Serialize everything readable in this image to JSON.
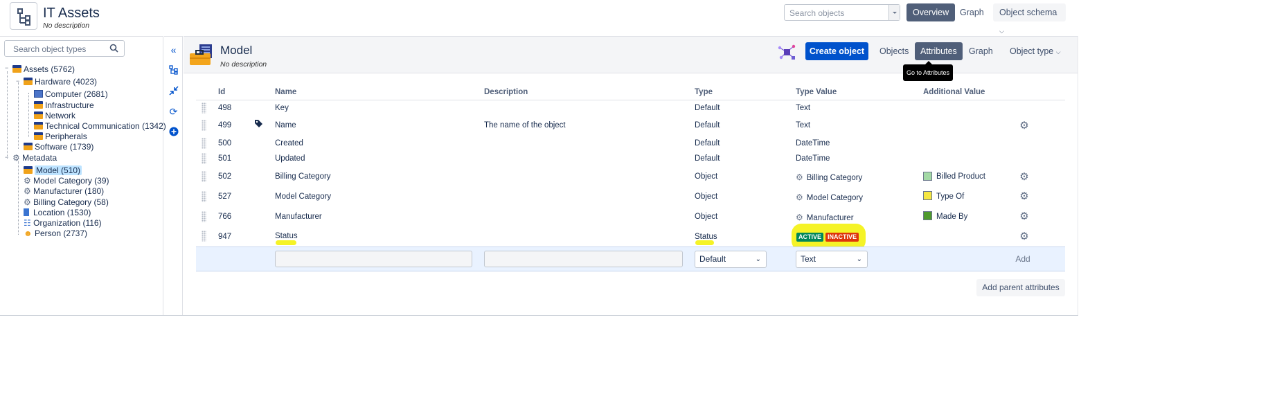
{
  "app": {
    "title": "IT Assets",
    "description": "No description"
  },
  "header": {
    "search_placeholder": "Search objects",
    "nav": {
      "overview": "Overview",
      "graph": "Graph",
      "object_schema": "Object schema"
    }
  },
  "sidebar": {
    "search_placeholder": "Search object types",
    "tree": [
      {
        "label": "Assets (5762)",
        "icon": "folder-icon"
      },
      {
        "label": "Hardware (4023)",
        "icon": "folder-icon"
      },
      {
        "label": "Computer (2681)",
        "icon": "monitor-icon"
      },
      {
        "label": "Infrastructure",
        "icon": "folder-icon"
      },
      {
        "label": "Network",
        "icon": "folder-icon"
      },
      {
        "label": "Technical Communication (1342)",
        "icon": "folder-icon"
      },
      {
        "label": "Peripherals",
        "icon": "folder-icon"
      },
      {
        "label": "Software (1739)",
        "icon": "folder-icon"
      },
      {
        "label": "Metadata",
        "icon": "gear-icon"
      },
      {
        "label": "Model (510)",
        "icon": "folder-icon",
        "selected": true
      },
      {
        "label": "Model Category (39)",
        "icon": "gear-icon"
      },
      {
        "label": "Manufacturer (180)",
        "icon": "gear-icon"
      },
      {
        "label": "Billing Category (58)",
        "icon": "gear-icon"
      },
      {
        "label": "Location (1530)",
        "icon": "building-icon"
      },
      {
        "label": "Organization (116)",
        "icon": "org-chart-icon"
      },
      {
        "label": "Person (2737)",
        "icon": "person-icon"
      }
    ]
  },
  "main": {
    "title": "Model",
    "description": "No description",
    "create_label": "Create object",
    "tabs": {
      "objects": "Objects",
      "attributes": "Attributes",
      "graph": "Graph",
      "object_type": "Object type"
    },
    "tooltip": "Go to Attributes",
    "columns": {
      "id": "Id",
      "name": "Name",
      "description": "Description",
      "type": "Type",
      "type_value": "Type Value",
      "additional_value": "Additional Value"
    },
    "rows": [
      {
        "id": "498",
        "name": "Key",
        "description": "",
        "type": "Default",
        "type_value": "Text",
        "additional": ""
      },
      {
        "id": "499",
        "name": "Name",
        "description": "The name of the object",
        "type": "Default",
        "type_value": "Text",
        "additional": ""
      },
      {
        "id": "500",
        "name": "Created",
        "description": "",
        "type": "Default",
        "type_value": "DateTime",
        "additional": ""
      },
      {
        "id": "501",
        "name": "Updated",
        "description": "",
        "type": "Default",
        "type_value": "DateTime",
        "additional": ""
      },
      {
        "id": "502",
        "name": "Billing Category",
        "description": "",
        "type": "Object",
        "type_value": "Billing Category",
        "additional": "Billed Product",
        "additional_color": "#a3d9a5"
      },
      {
        "id": "527",
        "name": "Model Category",
        "description": "",
        "type": "Object",
        "type_value": "Model Category",
        "additional": "Type Of",
        "additional_color": "#f5e642"
      },
      {
        "id": "766",
        "name": "Manufacturer",
        "description": "",
        "type": "Object",
        "type_value": "Manufacturer",
        "additional": "Made By",
        "additional_color": "#4f9a2e"
      },
      {
        "id": "947",
        "name": "Status",
        "description": "",
        "type": "Status",
        "type_value": "",
        "additional": ""
      }
    ],
    "status_badges": [
      {
        "label": "ACTIVE",
        "color": "#00875a"
      },
      {
        "label": "INACTIVE",
        "color": "#de350b"
      }
    ],
    "add_row": {
      "type_selected": "Default",
      "type_value_selected": "Text",
      "add_label": "Add"
    },
    "add_parent_label": "Add parent attributes"
  },
  "colors": {
    "primary": "#0052cc",
    "active_tab": "#505f79",
    "highlight": "#f4f20f"
  }
}
